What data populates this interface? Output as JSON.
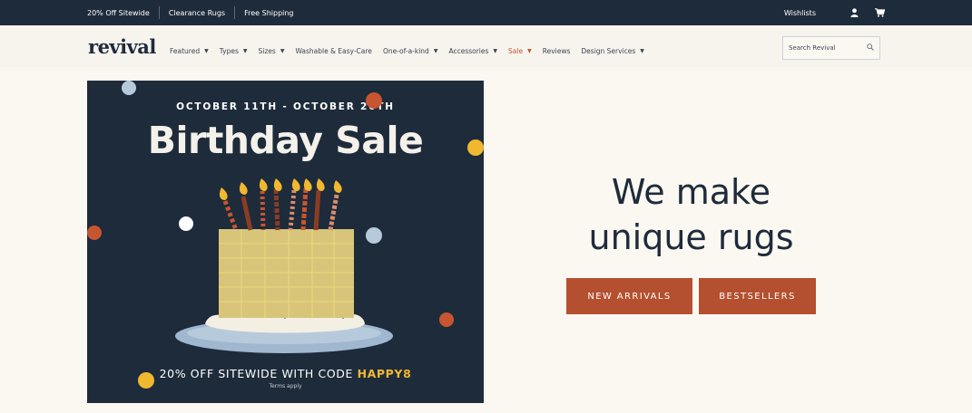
{
  "topbar": {
    "promos": [
      "20% Off Sitewide",
      "Clearance Rugs",
      "Free Shipping"
    ],
    "wishlists": "Wishlists",
    "icons": [
      "user-icon",
      "cart-icon"
    ]
  },
  "header": {
    "logo": "revival",
    "nav": [
      {
        "label": "Featured",
        "dropdown": true
      },
      {
        "label": "Types",
        "dropdown": true
      },
      {
        "label": "Sizes",
        "dropdown": true
      },
      {
        "label": "Washable & Easy-Care",
        "dropdown": false
      },
      {
        "label": "One-of-a-kind",
        "dropdown": true
      },
      {
        "label": "Accessories",
        "dropdown": true
      },
      {
        "label": "Sale",
        "dropdown": true
      },
      {
        "label": "Reviews",
        "dropdown": false
      },
      {
        "label": "Design Services",
        "dropdown": true
      }
    ],
    "search_placeholder": "Search Revival"
  },
  "banner": {
    "dates": "OCTOBER 11TH - OCTOBER 26TH",
    "title": "Birthday Sale",
    "offer_text": "20% OFF SITEWIDE WITH CODE ",
    "offer_code": "HAPPY8",
    "terms": "Terms apply"
  },
  "hero": {
    "title_line1": "We make",
    "title_line2": "unique rugs",
    "buttons": [
      "NEW ARRIVALS",
      "BESTSELLERS"
    ]
  },
  "colors": {
    "navy": "#1e2b3b",
    "rust": "#b4502f",
    "sale": "#c0532e",
    "gold": "#f0b82f",
    "cream": "#fbf8f2"
  }
}
